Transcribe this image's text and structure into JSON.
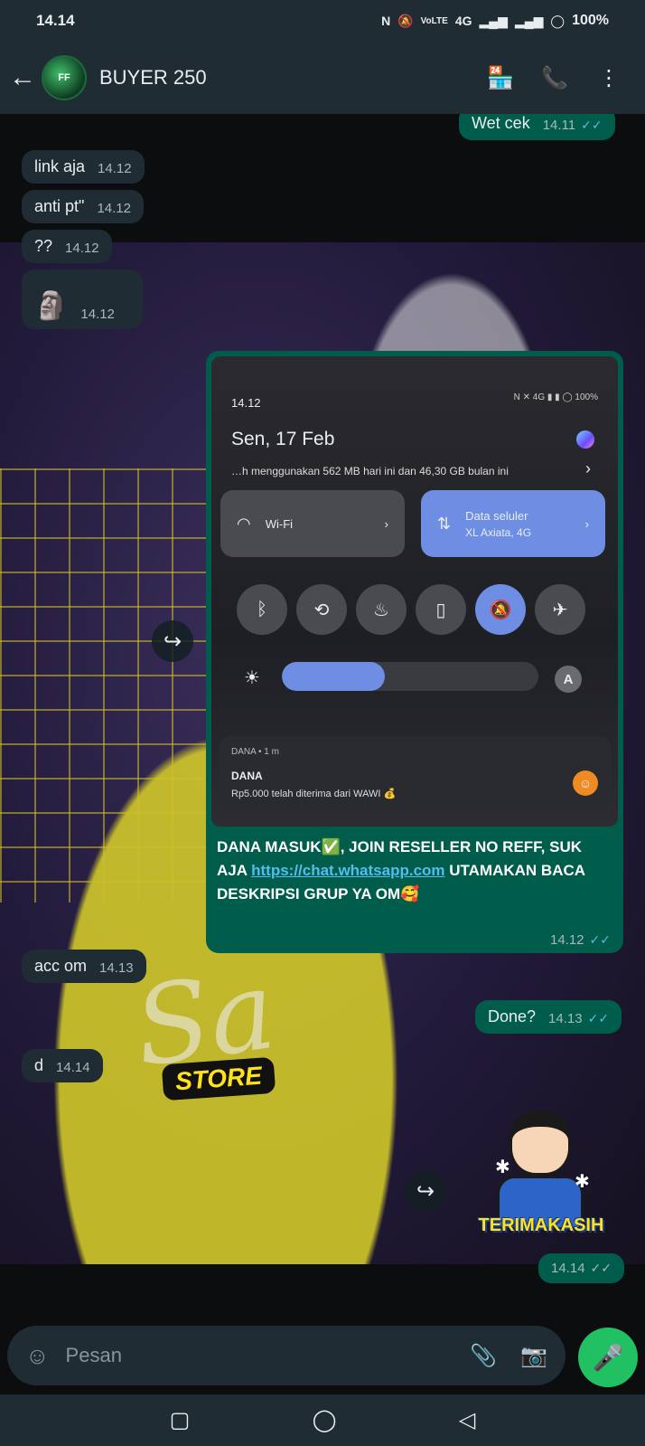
{
  "status_bar": {
    "time": "14.14",
    "icons": [
      "nfc-icon",
      "mute-icon",
      "volte-icon",
      "4g-icon",
      "signal-icon",
      "signal-icon"
    ],
    "volte": "VoLTE",
    "network": "4G",
    "battery": "100%"
  },
  "header": {
    "contact_name": "BUYER 250",
    "avatar_text": "FF"
  },
  "messages": [
    {
      "dir": "out",
      "text": "Wet cek",
      "time": "14.11",
      "read": true
    },
    {
      "dir": "in",
      "text": "link aja",
      "time": "14.12"
    },
    {
      "dir": "in",
      "text": "anti pt\"",
      "time": "14.12"
    },
    {
      "dir": "in",
      "text": "??",
      "time": "14.12"
    },
    {
      "dir": "in",
      "text": "",
      "time": "14.12",
      "sticker": true
    },
    {
      "dir": "in",
      "text": "acc om",
      "time": "14.13"
    },
    {
      "dir": "out",
      "text": "Done?",
      "time": "14.13",
      "read": true
    },
    {
      "dir": "in",
      "text": "d",
      "time": "14.14"
    },
    {
      "dir": "out",
      "text": "",
      "time": "14.14",
      "read": true,
      "sticker": true
    }
  ],
  "image_message": {
    "time": "14.12",
    "caption_part1": "DANA MASUK✅, JOIN RESELLER NO REFF, SUK AJA ",
    "caption_link": "https://chat.whatsapp.com",
    "caption_part2": " UTAMAKAN BACA DESKRIPSI GRUP YA OM🥰",
    "screenshot": {
      "time": "14.12",
      "status": "N ✕ 4G ▮ ▮ ◯ 100%",
      "date": "Sen, 17 Feb",
      "usage": "…h menggunakan 562 MB hari ini dan 46,30 GB bulan ini",
      "wifi_label": "Wi-Fi",
      "data_label": "Data seluler",
      "data_sub": "XL Axiata, 4G",
      "brightness": 0.4,
      "auto_label": "A",
      "notif_app": "DANA • 1 m",
      "notif_title": "DANA",
      "notif_body": "Rp5.000 telah diterima dari WAWI 💰"
    }
  },
  "wallpaper": {
    "store_label": "STORE",
    "big_text": "Sa"
  },
  "sticker": {
    "label": "TERIMAKASIH"
  },
  "input": {
    "placeholder": "Pesan"
  },
  "colors": {
    "header": "#1f2c33",
    "incoming": "#1f2c33",
    "outgoing": "#005c4b",
    "read_ticks": "#53bdeb",
    "mic": "#21c063"
  }
}
